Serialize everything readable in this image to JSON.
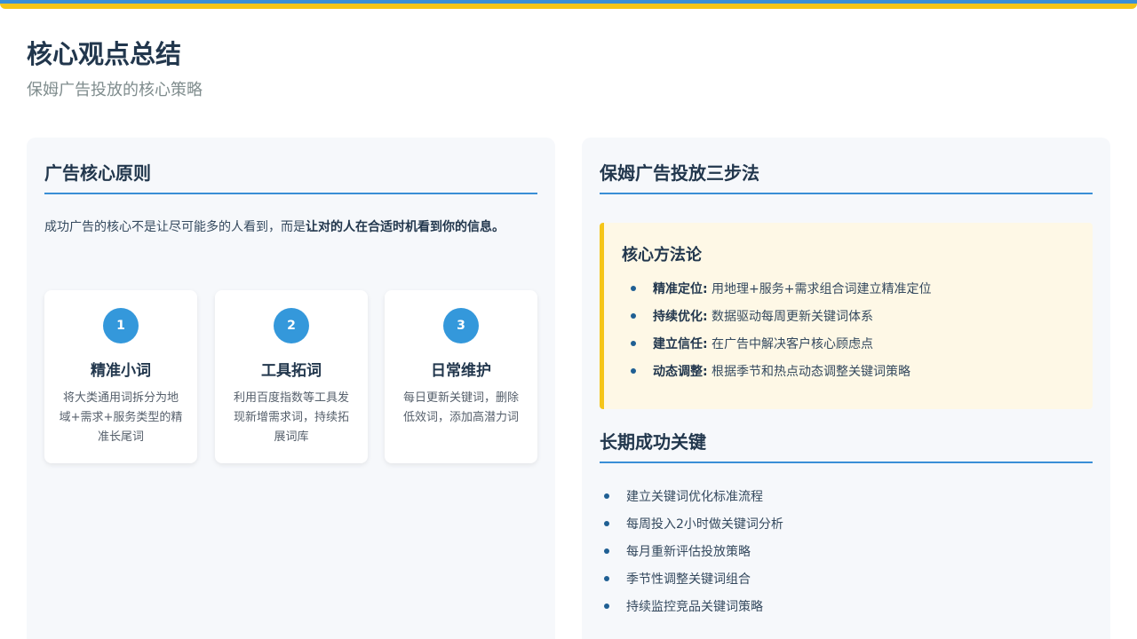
{
  "header": {
    "title": "核心观点总结",
    "subtitle": "保姆广告投放的核心策略"
  },
  "left": {
    "heading": "广告核心原则",
    "intro_plain": "成功广告的核心不是让尽可能多的人看到，而是",
    "intro_bold": "让对的人在合适时机看到你的信息。",
    "cards": [
      {
        "num": "1",
        "title": "精准小词",
        "desc": "将大类通用词拆分为地域+需求+服务类型的精准长尾词"
      },
      {
        "num": "2",
        "title": "工具拓词",
        "desc": "利用百度指数等工具发现新增需求词，持续拓展词库"
      },
      {
        "num": "3",
        "title": "日常维护",
        "desc": "每日更新关键词，删除低效词，添加高潜力词"
      }
    ]
  },
  "right": {
    "heading": "保姆广告投放三步法",
    "method": {
      "title": "核心方法论",
      "items": [
        {
          "label": "精准定位:",
          "text": " 用地理+服务+需求组合词建立精准定位"
        },
        {
          "label": "持续优化:",
          "text": " 数据驱动每周更新关键词体系"
        },
        {
          "label": "建立信任:",
          "text": " 在广告中解决客户核心顾虑点"
        },
        {
          "label": "动态调整:",
          "text": " 根据季节和热点动态调整关键词策略"
        }
      ]
    },
    "keys_heading": "长期成功关键",
    "keys": [
      "建立关键词优化标准流程",
      "每周投入2小时做关键词分析",
      "每月重新评估投放策略",
      "季节性调整关键词组合",
      "持续监控竞品关键词策略"
    ]
  },
  "colors": {
    "accent_blue": "#3a8fd6",
    "accent_yellow": "#f5c518",
    "number_badge": "#3498db",
    "highlight_bg": "#fef8e6"
  }
}
